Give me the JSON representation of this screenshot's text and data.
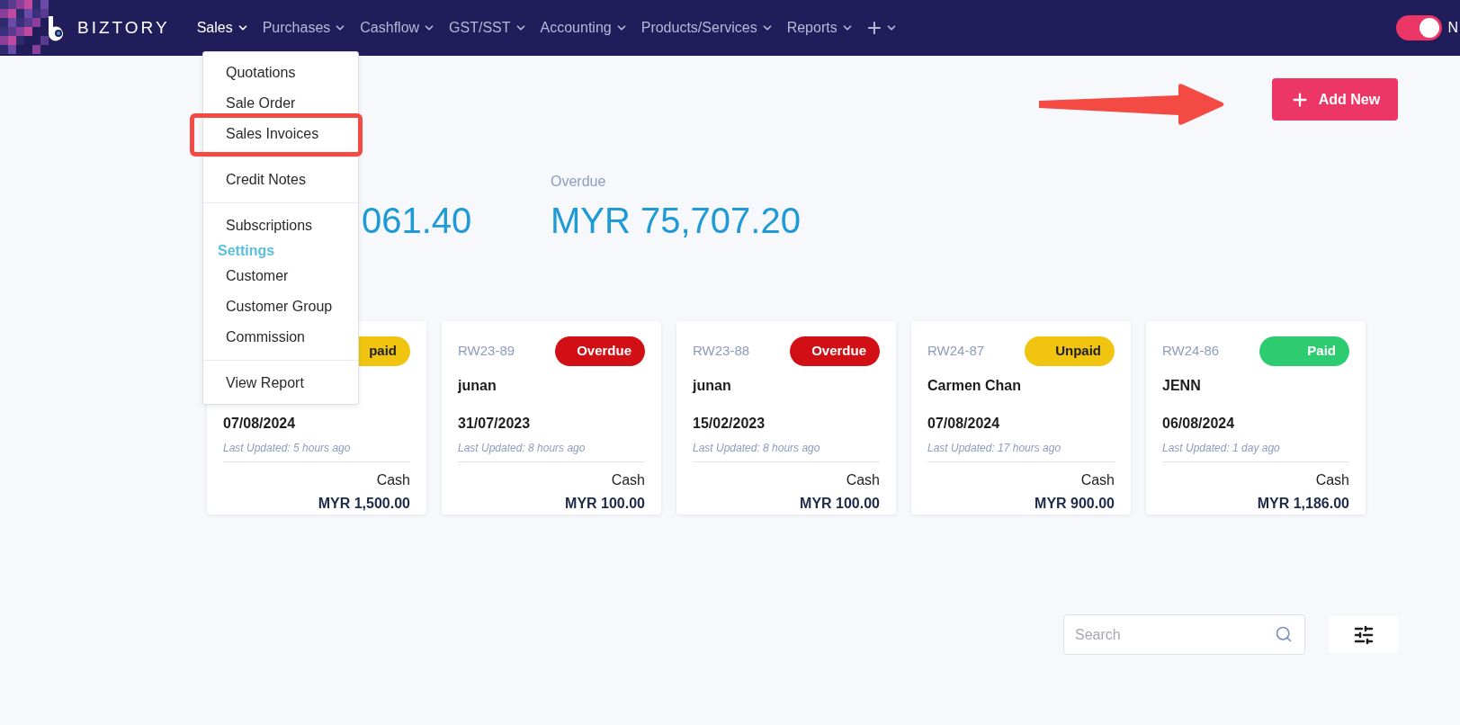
{
  "brand": {
    "name": "BIZTORY"
  },
  "nav": [
    {
      "label": "Sales",
      "selected": true
    },
    {
      "label": "Purchases",
      "selected": false
    },
    {
      "label": "Cashflow",
      "selected": false
    },
    {
      "label": "GST/SST",
      "selected": false
    },
    {
      "label": "Accounting",
      "selected": false
    },
    {
      "label": "Products/Services",
      "selected": false
    },
    {
      "label": "Reports",
      "selected": false
    },
    {
      "label": "+",
      "selected": false
    }
  ],
  "toggle": {
    "on": true,
    "label": "N"
  },
  "dropdown": [
    {
      "kind": "item",
      "label": "Quotations",
      "highlighted": false
    },
    {
      "kind": "item",
      "label": "Sale Order",
      "highlighted": false
    },
    {
      "kind": "item",
      "label": "Sales Invoices",
      "highlighted": true
    },
    {
      "kind": "divider"
    },
    {
      "kind": "item",
      "label": "Credit Notes",
      "highlighted": false
    },
    {
      "kind": "divider"
    },
    {
      "kind": "item",
      "label": "Subscriptions",
      "highlighted": false
    },
    {
      "kind": "header",
      "label": "Settings"
    },
    {
      "kind": "item",
      "label": "Customer",
      "highlighted": false
    },
    {
      "kind": "item",
      "label": "Customer Group",
      "highlighted": false
    },
    {
      "kind": "item",
      "label": "Commission",
      "highlighted": false
    },
    {
      "kind": "divider"
    },
    {
      "kind": "item",
      "label": "View Report",
      "highlighted": false
    }
  ],
  "add_button": {
    "label": "Add New"
  },
  "stats": [
    {
      "value": "061.40"
    },
    {
      "label": "Overdue",
      "value": "MYR 75,707.20"
    }
  ],
  "cards": [
    {
      "status": "paid",
      "color": "#f1c40f",
      "date": "07/08/2024",
      "updated": "Last Updated: 5 hours ago",
      "method": "Cash",
      "amount": "MYR 1,500.00"
    },
    {
      "number": "RW23-89",
      "status": "Overdue",
      "color": "#d10f14",
      "name": "junan",
      "date": "31/07/2023",
      "updated": "Last Updated: 8 hours ago",
      "method": "Cash",
      "amount": "MYR 100.00"
    },
    {
      "number": "RW23-88",
      "status": "Overdue",
      "color": "#d10f14",
      "name": "junan",
      "date": "15/02/2023",
      "updated": "Last Updated: 8 hours ago",
      "method": "Cash",
      "amount": "MYR 100.00"
    },
    {
      "number": "RW24-87",
      "status": "Unpaid",
      "color": "#f1c40f",
      "name": "Carmen Chan",
      "date": "07/08/2024",
      "updated": "Last Updated: 17 hours ago",
      "method": "Cash",
      "amount": "MYR 900.00"
    },
    {
      "number": "RW24-86",
      "status": "Paid",
      "color": "#2ecc71",
      "name": "JENN",
      "date": "06/08/2024",
      "updated": "Last Updated: 1 day ago",
      "method": "Cash",
      "amount": "MYR 1,186.00"
    }
  ],
  "search": {
    "placeholder": "Search"
  }
}
